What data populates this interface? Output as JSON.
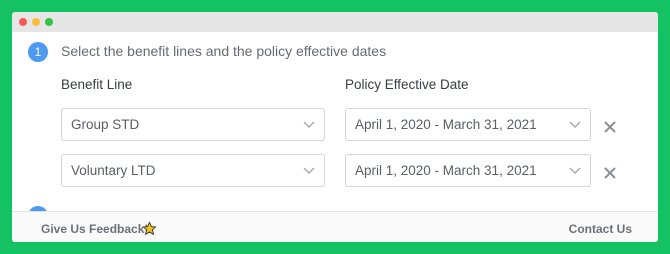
{
  "step1": {
    "number": "1",
    "title": "Select the benefit lines and the policy effective dates"
  },
  "columns": {
    "benefit_line": "Benefit Line",
    "policy_effective_date": "Policy Effective Date"
  },
  "rows": [
    {
      "benefit_line": "Group STD",
      "policy_date": "April 1, 2020 - March 31, 2021"
    },
    {
      "benefit_line": "Voluntary LTD",
      "policy_date": "April 1, 2020 - March 31, 2021"
    }
  ],
  "footer": {
    "feedback_label": "Give Us Feedback!",
    "contact_label": "Contact Us"
  },
  "colors": {
    "background": "#14c264",
    "accent": "#4d9af0",
    "star": "#f5c518"
  },
  "icons": [
    "chevron-down-icon",
    "close-icon",
    "star-icon"
  ]
}
